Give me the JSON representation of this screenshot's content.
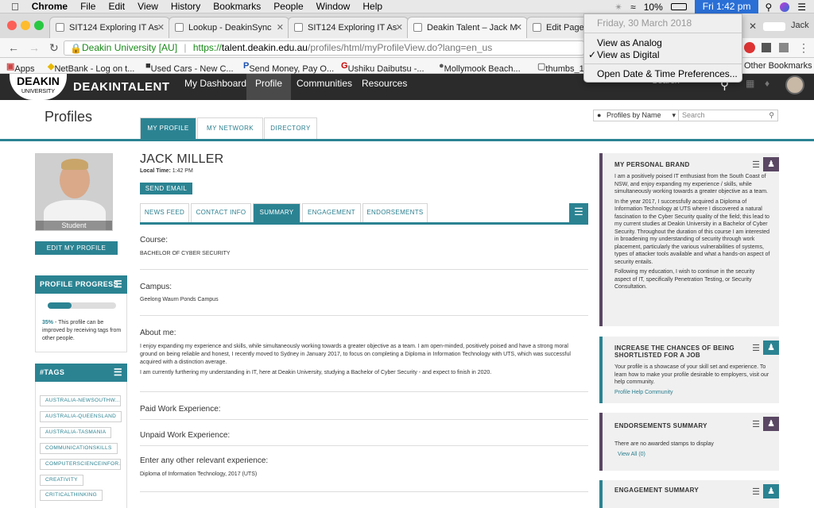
{
  "menubar": {
    "app": "Chrome",
    "items": [
      "File",
      "Edit",
      "View",
      "History",
      "Bookmarks",
      "People",
      "Window",
      "Help"
    ],
    "battery": "10%",
    "clock": "Fri 1:42 pm"
  },
  "tabs": [
    {
      "label": "SIT124 Exploring IT As"
    },
    {
      "label": "Lookup - DeakinSync"
    },
    {
      "label": "SIT124 Exploring IT As"
    },
    {
      "label": "Deakin Talent – Jack M"
    },
    {
      "label": "Edit Page"
    }
  ],
  "profile_user": "Jack",
  "address": {
    "secure_label": "Deakin University [AU]",
    "separator": "|",
    "scheme": "https://",
    "host": "talent.deakin.edu.au",
    "path": "/profiles/html/myProfileView.do?lang=en_us"
  },
  "bookmarks": [
    "Apps",
    "NetBank - Log on t...",
    "Used Cars - New C...",
    "Send Money, Pay O...",
    "Ushiku Daibutsu -...",
    "Mollymook Beach...",
    "thumbs_1",
    "Other Bookmarks"
  ],
  "dropdown": {
    "date": "Friday, 30 March 2018",
    "analog": "View as Analog",
    "digital": "View as Digital",
    "prefs": "Open Date & Time Preferences..."
  },
  "site": {
    "logo": "DEAKIN",
    "logo_sub": "UNIVERSITY",
    "brand": "DEAKINTALENT",
    "nav": [
      "My Dashboard",
      "Profile",
      "Communities",
      "Resources"
    ],
    "search_placeholder": "Search"
  },
  "page": {
    "title": "Profiles",
    "tabs": [
      "MY PROFILE",
      "MY NETWORK",
      "DIRECTORY"
    ],
    "profiles_by": "Profiles by Name",
    "search_placeholder": "Search"
  },
  "left": {
    "photo_label": "Student",
    "edit_btn": "EDIT MY PROFILE",
    "progress_title": "PROFILE PROGRESS",
    "progress_fraction": 0.35,
    "progress_pct": "35%",
    "progress_text": " - This profile can be improved by receiving tags from other people.",
    "tags_title": "#TAGS",
    "tags": [
      "AUSTRALIA-NEWSOUTHW...",
      "AUSTRALIA-QUEENSLAND",
      "AUSTRALIA-TASMANIA",
      "COMMUNICATIONSKILLS",
      "COMPUTERSCIENCEINFOR...",
      "CREATIVITY",
      "CRITICALTHINKING"
    ]
  },
  "person": {
    "name": "JACK MILLER",
    "local_time_label": "Local Time:",
    "local_time": "1:42 PM",
    "send_email": "SEND EMAIL"
  },
  "subtabs": [
    "NEWS FEED",
    "CONTACT INFO",
    "SUMMARY",
    "ENGAGEMENT",
    "ENDORSEMENTS"
  ],
  "summary": {
    "course_h": "Course:",
    "course": "BACHELOR OF CYBER SECURITY",
    "campus_h": "Campus:",
    "campus": "Geelong Waurn Ponds Campus",
    "about_h": "About me:",
    "about_1": "I enjoy expanding my experience and skills, while simultaneously working towards a greater objective as a team. I am open-minded, positively poised and have a strong moral ground on being reliable and honest, I recently moved to Sydney in January 2017, to focus on completing a Diploma in Information Technology with UTS, which was successful acquired with a distinction average.",
    "about_2": "I am currently furthering my understanding in IT, here at Deakin University, studying a Bachelor of Cyber Security - and expect to finish in 2020.",
    "paid_h": "Paid Work Experience:",
    "unpaid_h": "Unpaid Work Experience:",
    "other_h": "Enter any other relevant experience:",
    "other": "Diploma of Information Technology, 2017 (UTS)"
  },
  "right": {
    "brand_title": "MY PERSONAL BRAND",
    "brand_p1": "I am a positively poised IT enthusiast from the South Coast of NSW, and enjoy expanding my experience / skills, while simultaneously working towards a greater objective as a team.",
    "brand_p2": "In the year 2017, I successfully acquired a Diploma of Information Technology at UTS where I discovered a natural fascination to the Cyber Security quality of the field; this lead to my current studies at Deakin University in a Bachelor of Cyber Security. Throughout the duration of this course I am interested in broadening my understanding of security through work placement, particularly the various vulnerabilities of systems, types of attacker tools available and what a hands-on aspect of security entails.",
    "brand_p3": "Following my education, I wish to continue in the security aspect of IT, specifically Penetration Testing, or Security Consultation.",
    "chances_title": "INCREASE THE CHANCES OF BEING SHORTLISTED FOR A JOB",
    "chances_p1": "Your profile is a showcase of your skill set and experience. To learn how to make your profile desirable to employers, visit our help community.",
    "chances_link": "Profile Help Community",
    "endorse_title": "ENDORSEMENTS SUMMARY",
    "endorse_text": "There are no awarded stamps to display",
    "endorse_link": "View All (0)",
    "engage_title": "ENGAGEMENT SUMMARY"
  }
}
